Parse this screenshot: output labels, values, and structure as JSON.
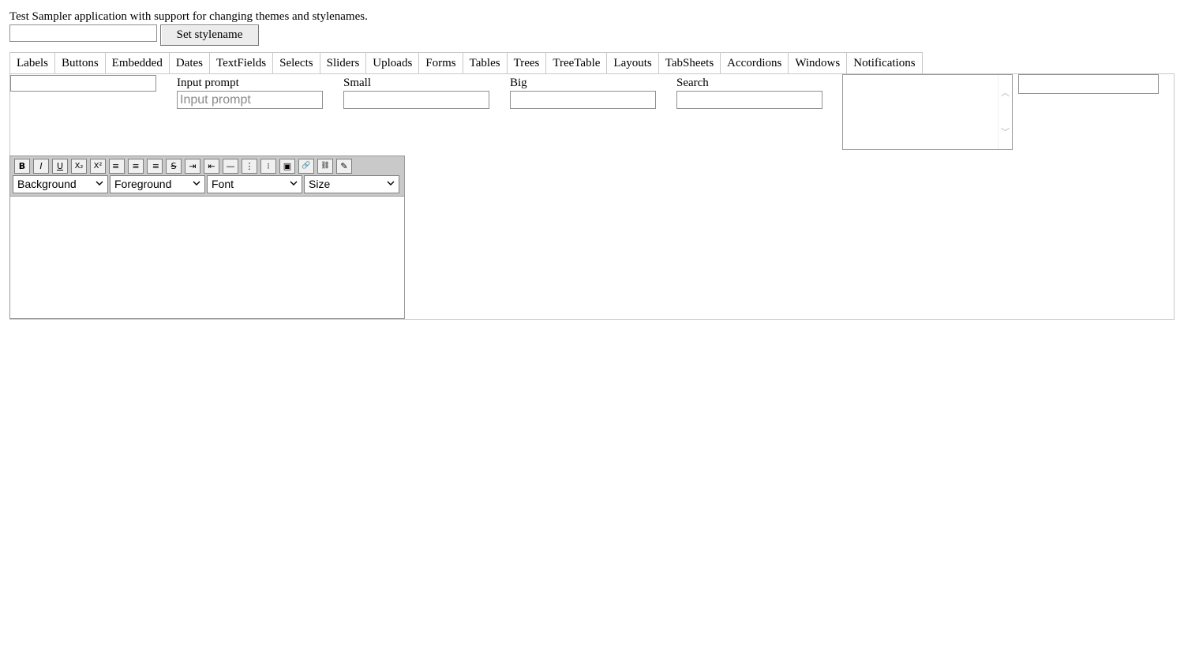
{
  "header": {
    "description": "Test Sampler application with support for changing themes and stylenames.",
    "stylename_value": "",
    "set_stylename_label": "Set stylename"
  },
  "tabs": [
    {
      "label": "Labels",
      "active": false
    },
    {
      "label": "Buttons",
      "active": false
    },
    {
      "label": "Embedded",
      "active": false
    },
    {
      "label": "Dates",
      "active": false
    },
    {
      "label": "TextFields",
      "active": true
    },
    {
      "label": "Selects",
      "active": false
    },
    {
      "label": "Sliders",
      "active": false
    },
    {
      "label": "Uploads",
      "active": false
    },
    {
      "label": "Forms",
      "active": false
    },
    {
      "label": "Tables",
      "active": false
    },
    {
      "label": "Trees",
      "active": false
    },
    {
      "label": "TreeTable",
      "active": false
    },
    {
      "label": "Layouts",
      "active": false
    },
    {
      "label": "TabSheets",
      "active": false
    },
    {
      "label": "Accordions",
      "active": false
    },
    {
      "label": "Windows",
      "active": false
    },
    {
      "label": "Notifications",
      "active": false
    }
  ],
  "textfields": {
    "plain_value": "",
    "input_prompt": {
      "caption": "Input prompt",
      "placeholder": "Input prompt",
      "value": ""
    },
    "small": {
      "caption": "Small",
      "value": ""
    },
    "big": {
      "caption": "Big",
      "value": ""
    },
    "search": {
      "caption": "Search",
      "value": ""
    },
    "textarea_value": "",
    "right_value": ""
  },
  "rich_text": {
    "toolbar_buttons": [
      {
        "name": "bold-button",
        "icon": "B"
      },
      {
        "name": "italic-button",
        "icon": "I"
      },
      {
        "name": "underline-button",
        "icon": "U"
      },
      {
        "name": "subscript-button",
        "icon": "X₂"
      },
      {
        "name": "superscript-button",
        "icon": "X²"
      },
      {
        "name": "align-left-button",
        "icon": "≡"
      },
      {
        "name": "align-center-button",
        "icon": "≡"
      },
      {
        "name": "align-right-button",
        "icon": "≡"
      },
      {
        "name": "strikethrough-button",
        "icon": "S"
      },
      {
        "name": "indent-button",
        "icon": "⇥"
      },
      {
        "name": "outdent-button",
        "icon": "⇤"
      },
      {
        "name": "horizontal-rule-button",
        "icon": "—"
      },
      {
        "name": "ordered-list-button",
        "icon": "⋮"
      },
      {
        "name": "unordered-list-button",
        "icon": "⁝"
      },
      {
        "name": "insert-image-button",
        "icon": "▣"
      },
      {
        "name": "create-link-button",
        "icon": "🔗"
      },
      {
        "name": "remove-link-button",
        "icon": "⛓"
      },
      {
        "name": "remove-format-button",
        "icon": "✎"
      }
    ],
    "selects": {
      "background": "Background",
      "foreground": "Foreground",
      "font": "Font",
      "size": "Size"
    },
    "content": ""
  }
}
